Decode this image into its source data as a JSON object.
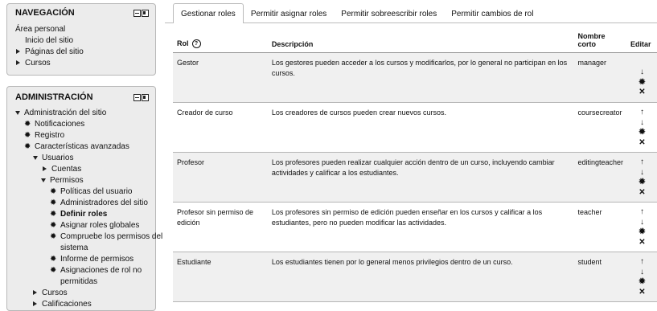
{
  "navigation": {
    "title": "NAVEGACIÓN",
    "items": [
      "Área personal",
      "Inicio del sitio",
      "Páginas del sitio",
      "Cursos"
    ]
  },
  "administration": {
    "title": "ADMINISTRACIÓN",
    "site_admin": "Administración del sitio",
    "notifications": "Notificaciones",
    "registration": "Registro",
    "advanced_features": "Características avanzadas",
    "users": "Usuarios",
    "accounts": "Cuentas",
    "permissions": "Permisos",
    "perm_items": [
      "Políticas del usuario",
      "Administradores del sitio",
      "Definir roles",
      "Asignar roles globales",
      "Compruebe los permisos del",
      "sistema",
      "Informe de permisos",
      "Asignaciones de rol no",
      "permitidas"
    ],
    "courses": "Cursos",
    "grades": "Calificaciones"
  },
  "tabs": [
    "Gestionar roles",
    "Permitir asignar roles",
    "Permitir sobreescribir roles",
    "Permitir cambios de rol"
  ],
  "table": {
    "headers": {
      "role": "Rol",
      "description": "Descripción",
      "shortname_1": "Nombre",
      "shortname_2": "corto",
      "edit": "Editar"
    },
    "rows": [
      {
        "role": "Gestor",
        "description": "Los gestores pueden acceder a los cursos y modificarlos, por lo general no participan en los cursos.",
        "shortname": "manager"
      },
      {
        "role": "Creador de curso",
        "description": "Los creadores de cursos pueden crear nuevos cursos.",
        "shortname": "coursecreator"
      },
      {
        "role": "Profesor",
        "description": "Los profesores pueden realizar cualquier acción dentro de un curso, incluyendo cambiar actividades y calificar a los estudiantes.",
        "shortname": "editingteacher"
      },
      {
        "role": "Profesor sin permiso de edición",
        "description": "Los profesores sin permiso de edición pueden enseñar en los cursos y calificar a los estudiantes, pero no pueden modificar las actividades.",
        "shortname": "teacher"
      },
      {
        "role": "Estudiante",
        "description": "Los estudiantes tienen por lo general menos privilegios dentro de un curso.",
        "shortname": "student"
      }
    ]
  },
  "icons": {
    "up": "arrow-up-icon",
    "down": "arrow-down-icon",
    "edit": "gear-icon",
    "delete": "delete-icon"
  }
}
